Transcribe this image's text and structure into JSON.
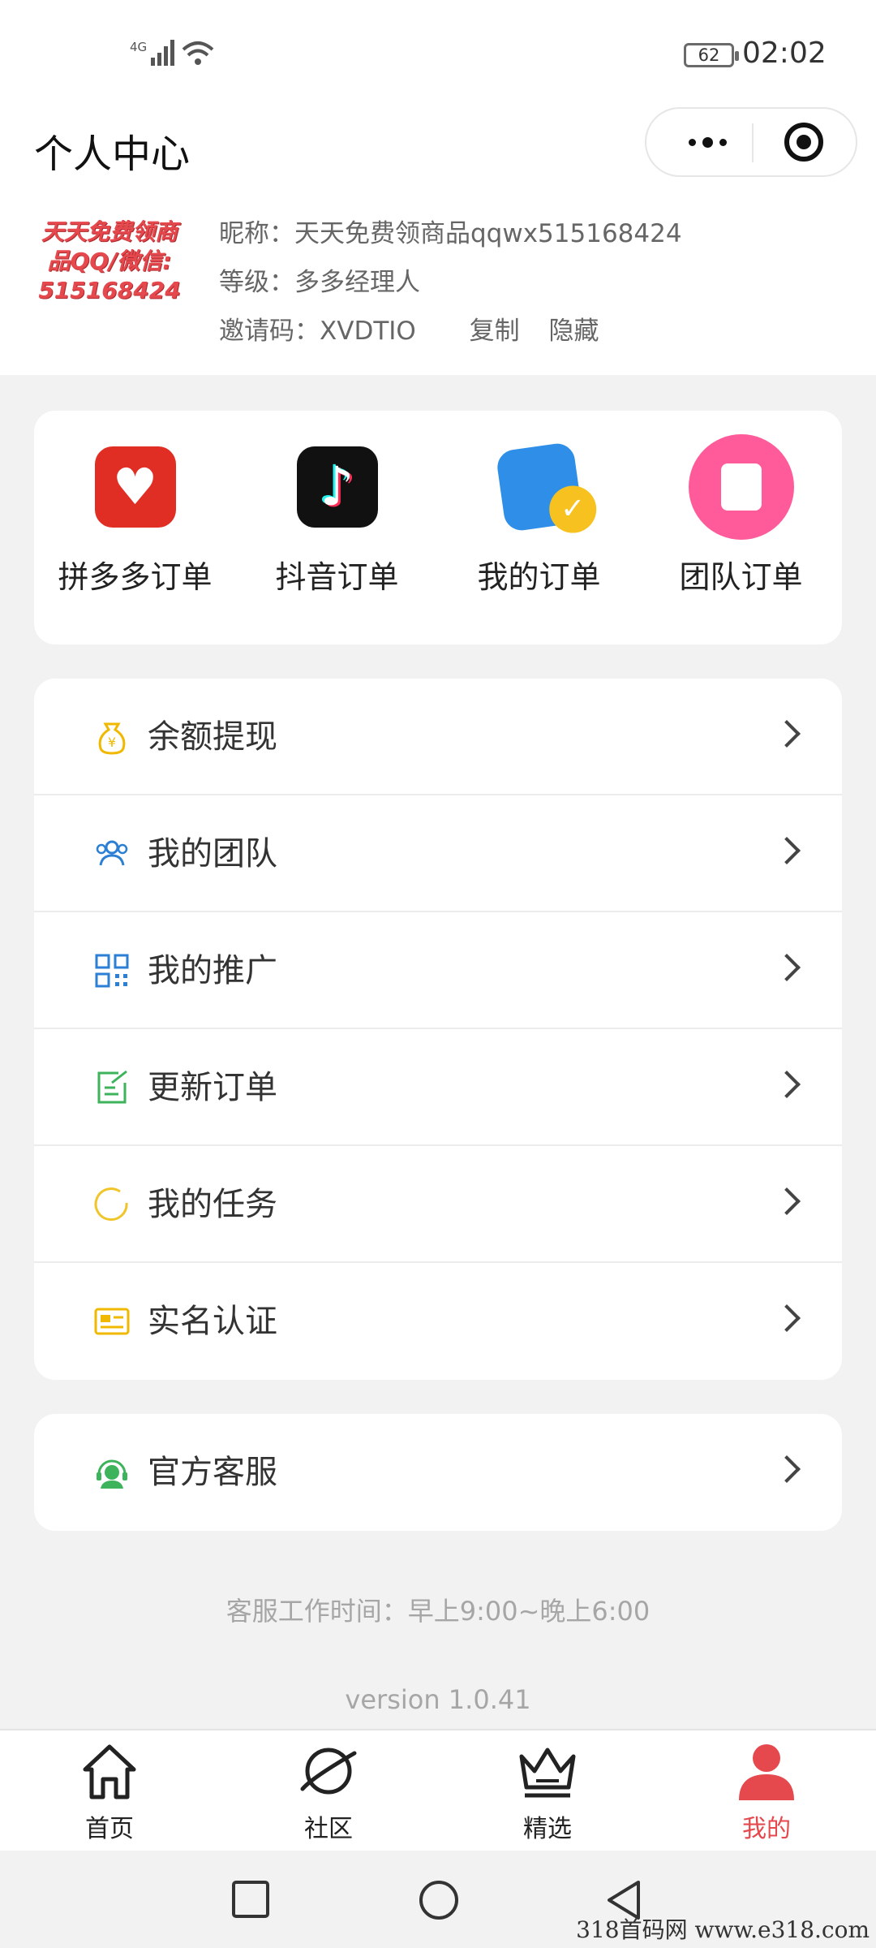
{
  "status_bar": {
    "network": "4G",
    "battery": "62",
    "time": "02:02"
  },
  "header": {
    "title": "个人中心"
  },
  "profile": {
    "avatar_text": [
      "天天免费领商",
      "品QQ/微信:",
      "515168424"
    ],
    "nickname": "昵称：天天免费领商品qqwx515168424",
    "level": "等级：多多经理人",
    "invite": "邀请码：XVDTIO",
    "copy_label": "复制",
    "hide_label": "隐藏"
  },
  "orders": [
    {
      "label": "拼多多订单",
      "icon": "pinduoduo-icon"
    },
    {
      "label": "抖音订单",
      "icon": "douyin-icon"
    },
    {
      "label": "我的订单",
      "icon": "calendar-check-icon"
    },
    {
      "label": "团队订单",
      "icon": "document-icon"
    }
  ],
  "menu": [
    {
      "label": "余额提现",
      "icon": "money-bag-icon",
      "color": "#f0b800"
    },
    {
      "label": "我的团队",
      "icon": "team-icon",
      "color": "#2b7fd4"
    },
    {
      "label": "我的推广",
      "icon": "qrcode-icon",
      "color": "#2b7fd4"
    },
    {
      "label": "更新订单",
      "icon": "edit-icon",
      "color": "#3db35b"
    },
    {
      "label": "我的任务",
      "icon": "circle-icon",
      "color": "#f0c52a"
    },
    {
      "label": "实名认证",
      "icon": "id-card-icon",
      "color": "#f0b800"
    }
  ],
  "service": {
    "label": "官方客服",
    "icon": "headset-icon",
    "color": "#3db35b"
  },
  "footer": {
    "hours": "客服工作时间：早上9:00~晚上6:00",
    "version": "version 1.0.41"
  },
  "tabs": [
    {
      "label": "首页",
      "icon": "home-icon"
    },
    {
      "label": "社区",
      "icon": "planet-icon"
    },
    {
      "label": "精选",
      "icon": "crown-icon"
    },
    {
      "label": "我的",
      "icon": "user-icon",
      "active": true
    }
  ],
  "watermark": "318首码网  www.e318.com",
  "accent": "#e5484d"
}
